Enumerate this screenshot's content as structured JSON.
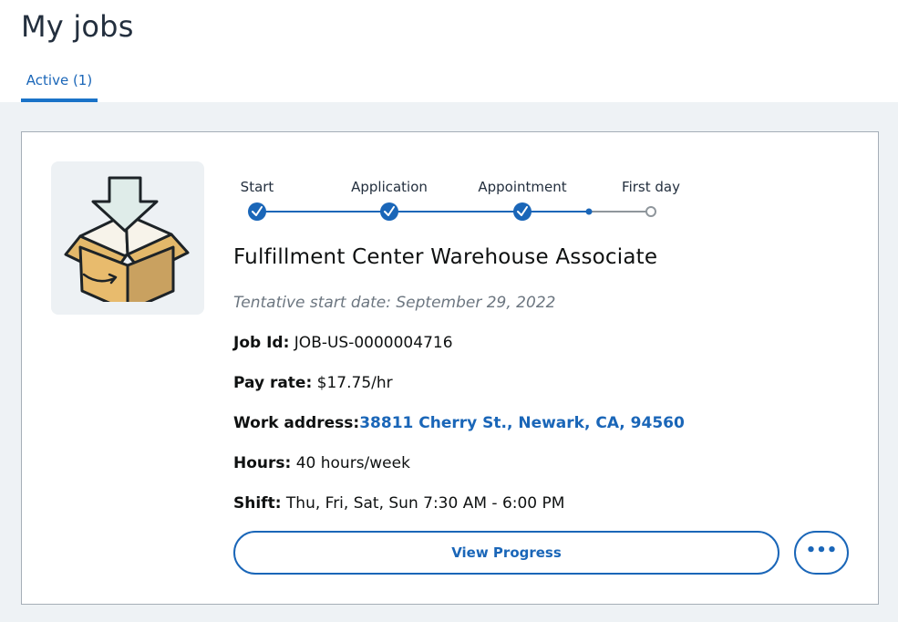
{
  "page": {
    "title": "My jobs"
  },
  "tabs": [
    {
      "label": "Active (1)",
      "active": true
    }
  ],
  "progress": {
    "steps": [
      {
        "label": "Start",
        "state": "complete"
      },
      {
        "label": "Application",
        "state": "complete"
      },
      {
        "label": "Appointment",
        "state": "complete"
      },
      {
        "label": "First day",
        "state": "pending"
      }
    ],
    "colors": {
      "complete": "#1a66b8",
      "pending": "#8f969c"
    }
  },
  "job": {
    "title": "Fulfillment Center Warehouse Associate",
    "start_date": "Tentative start date: September 29, 2022",
    "job_id_label": "Job Id:",
    "job_id": "JOB-US-0000004716",
    "pay_label": "Pay rate:",
    "pay": "$17.75/hr",
    "address_label": "Work address:",
    "address": "38811 Cherry St., Newark, CA, 94560",
    "hours_label": "Hours:",
    "hours": "40 hours/week",
    "shift_label": "Shift:",
    "shift": "Thu, Fri, Sat, Sun 7:30 AM - 6:00 PM",
    "icon": "box-download-icon"
  },
  "actions": {
    "view_progress": "View Progress",
    "more_label": "•••",
    "more_icon": "ellipsis-icon"
  }
}
